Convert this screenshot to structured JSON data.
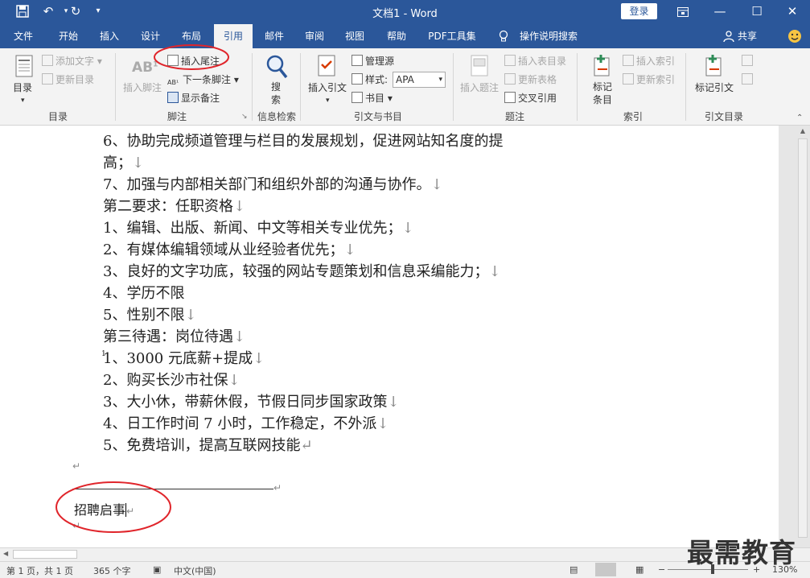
{
  "title": "文档1  -  Word",
  "login_label": "登录",
  "share_label": "共享",
  "tabs": [
    "文件",
    "开始",
    "插入",
    "设计",
    "布局",
    "引用",
    "邮件",
    "审阅",
    "视图",
    "帮助",
    "PDF工具集",
    "操作说明搜索"
  ],
  "ribbon": {
    "toc": {
      "big": "目录",
      "add_text": "添加文字",
      "update_toc": "更新目录",
      "group": "目录"
    },
    "footnote": {
      "insert_footnote": "插入脚注",
      "insert_endnote": "插入尾注",
      "next_footnote": "下一条脚注",
      "show_notes": "显示备注",
      "group": "脚注"
    },
    "research": {
      "search": "搜索",
      "group": "信息检索"
    },
    "citations": {
      "insert_citation": "插入引文",
      "manage_sources": "管理源",
      "style_label": "样式:",
      "style_value": "APA",
      "bibliography": "书目",
      "group": "引文与书目"
    },
    "captions": {
      "insert_caption": "插入题注",
      "insert_table_fig": "插入表目录",
      "update_table": "更新表格",
      "cross_ref": "交叉引用",
      "group": "题注"
    },
    "index": {
      "mark_entry": "标记条目",
      "insert_index": "插入索引",
      "update_index": "更新索引",
      "group": "索引"
    },
    "toa": {
      "mark_citation": "标记引文",
      "group": "引文目录"
    }
  },
  "document": {
    "lines": [
      "6、协助完成频道管理与栏目的发展规划，促进网站知名度的提",
      "高；",
      "7、加强与内部相关部门和组织外部的沟通与协作。",
      "第二要求：任职资格",
      "1、编辑、出版、新闻、中文等相关专业优先；",
      "2、有媒体编辑领域从业经验者优先；",
      "3、良好的文字功底，较强的网站专题策划和信息采编能力；",
      "4、学历不限",
      "5、性别不限",
      "第三待遇：岗位待遇",
      "1、3000 元底薪+提成",
      "2、购买长沙市社保",
      "3、大小休，带薪休假，节假日同步国家政策",
      "4、日工作时间 7 小时，工作稳定，不外派",
      "5、免费培训，提高互联网技能"
    ],
    "endnote_ref": "1",
    "endnote_text": "招聘启事"
  },
  "status": {
    "page": "第 1 页，共 1 页",
    "words": "365 个字",
    "lang": "中文(中国)",
    "zoom": "130%"
  },
  "watermark": "最需教育",
  "colors": {
    "accent": "#2b579a",
    "annotation": "#e0252b"
  }
}
